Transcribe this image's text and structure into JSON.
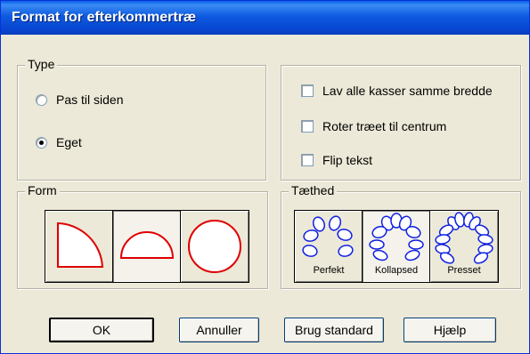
{
  "window": {
    "title": "Format for efterkommertræ"
  },
  "type_group": {
    "legend": "Type",
    "options": [
      {
        "label": "Pas til siden",
        "selected": false
      },
      {
        "label": "Eget",
        "selected": true
      }
    ]
  },
  "options_group": {
    "checkboxes": [
      {
        "label": "Lav alle kasser samme bredde",
        "checked": false
      },
      {
        "label": "Roter træet til centrum",
        "checked": false
      },
      {
        "label": "Flip tekst",
        "checked": false
      }
    ]
  },
  "form_group": {
    "legend": "Form",
    "shapes": [
      {
        "icon": "quarter-circle-icon",
        "pressed": false
      },
      {
        "icon": "half-circle-icon",
        "pressed": true
      },
      {
        "icon": "full-circle-icon",
        "pressed": false
      }
    ]
  },
  "density_group": {
    "legend": "Tæthed",
    "options": [
      {
        "label": "Perfekt",
        "icon": "fan-perfect-icon",
        "pressed": false
      },
      {
        "label": "Kollapsed",
        "icon": "fan-collapsed-icon",
        "pressed": true
      },
      {
        "label": "Presset",
        "icon": "fan-pressed-icon",
        "pressed": false
      }
    ]
  },
  "buttons": {
    "ok": "OK",
    "cancel": "Annuller",
    "default": "Brug standard",
    "help": "Hjælp"
  },
  "colors": {
    "title_bar": "#0a5ee8",
    "shape_stroke": "#e00000",
    "fan_stroke": "#1020e0"
  }
}
